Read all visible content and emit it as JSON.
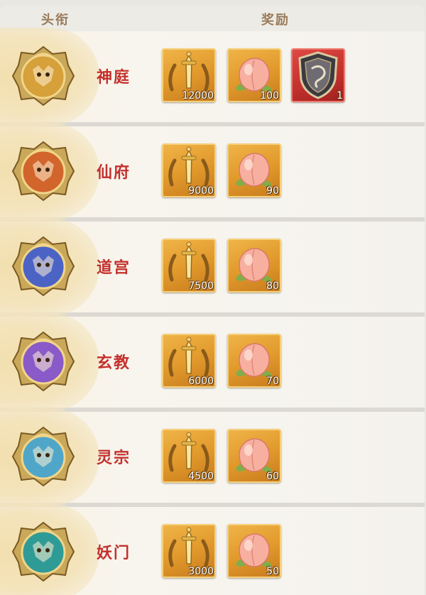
{
  "header": {
    "title_col": "头衔",
    "reward_col": "奖励"
  },
  "rows": [
    {
      "rank": "神庭",
      "emblem_icon": "gold-dragon-emblem-icon",
      "emblem_color": "#d6a03a",
      "rewards": [
        {
          "icon": "sword-laurel-icon",
          "qty": "12000"
        },
        {
          "icon": "peach-icon",
          "qty": "100"
        },
        {
          "icon": "dragon-shield-icon",
          "qty": "1"
        }
      ]
    },
    {
      "rank": "仙府",
      "emblem_icon": "orange-phoenix-emblem-icon",
      "emblem_color": "#d2652c",
      "rewards": [
        {
          "icon": "sword-laurel-icon",
          "qty": "9000"
        },
        {
          "icon": "peach-icon",
          "qty": "90"
        }
      ]
    },
    {
      "rank": "道宫",
      "emblem_icon": "blue-beast-emblem-icon",
      "emblem_color": "#4c63c6",
      "rewards": [
        {
          "icon": "sword-laurel-icon",
          "qty": "7500"
        },
        {
          "icon": "peach-icon",
          "qty": "80"
        }
      ]
    },
    {
      "rank": "玄教",
      "emblem_icon": "purple-ox-emblem-icon",
      "emblem_color": "#8a5ac8",
      "rewards": [
        {
          "icon": "sword-laurel-icon",
          "qty": "6000"
        },
        {
          "icon": "peach-icon",
          "qty": "70"
        }
      ]
    },
    {
      "rank": "灵宗",
      "emblem_icon": "cyan-lion-emblem-icon",
      "emblem_color": "#4fa6c9",
      "rewards": [
        {
          "icon": "sword-laurel-icon",
          "qty": "4500"
        },
        {
          "icon": "peach-icon",
          "qty": "60"
        }
      ]
    },
    {
      "rank": "妖门",
      "emblem_icon": "teal-serpent-emblem-icon",
      "emblem_color": "#2f9b96",
      "rewards": [
        {
          "icon": "sword-laurel-icon",
          "qty": "3000"
        },
        {
          "icon": "peach-icon",
          "qty": "50"
        }
      ]
    }
  ]
}
